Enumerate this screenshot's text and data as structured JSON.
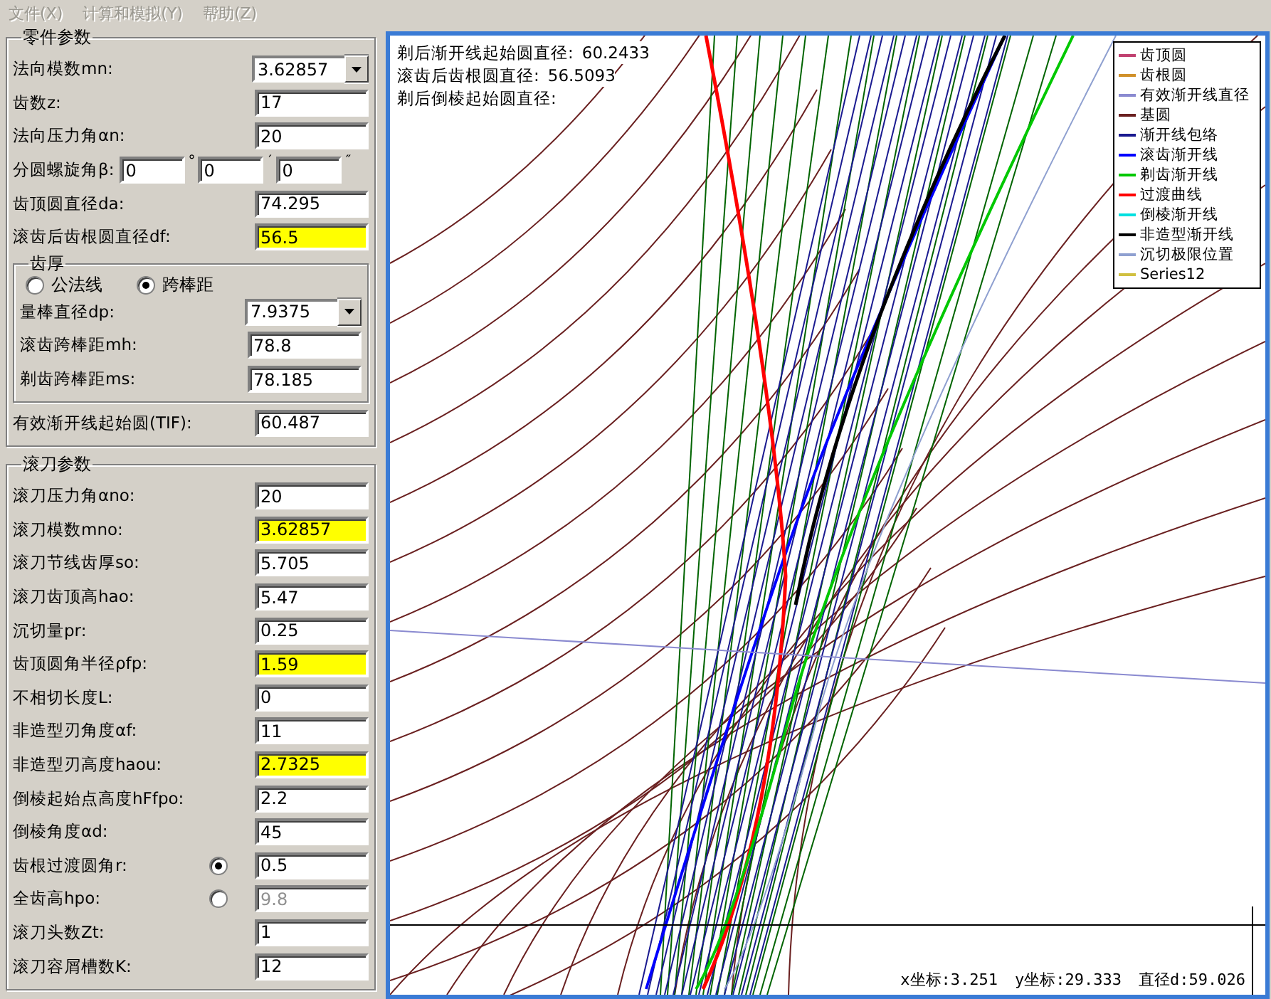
{
  "menu": [
    {
      "label": "文件(X)",
      "disabled": true
    },
    {
      "label": "计算和模拟(Y)",
      "disabled": true
    },
    {
      "label": "帮助(Z)",
      "disabled": true
    }
  ],
  "part_params": {
    "title": "零件参数",
    "items": [
      {
        "kind": "combo",
        "label": "法向模数mn:",
        "value": "3.62857",
        "highlighted": false
      },
      {
        "kind": "text",
        "label": "齿数z:",
        "value": "17",
        "highlighted": false
      },
      {
        "kind": "text",
        "label": "法向压力角αn:",
        "value": "20",
        "highlighted": false
      },
      {
        "kind": "angle",
        "label": "分圆螺旋角β:",
        "parts": [
          {
            "value": "0",
            "unit": "°"
          },
          {
            "value": "0",
            "unit": "′"
          },
          {
            "value": "0",
            "unit": "″"
          }
        ]
      },
      {
        "kind": "text",
        "label": "齿顶圆直径da:",
        "value": "74.295",
        "highlighted": false
      },
      {
        "kind": "text",
        "label": "滚齿后齿根圆直径df:",
        "value": "56.5",
        "highlighted": true
      },
      {
        "kind": "group",
        "title": "齿厚",
        "options": [
          {
            "label": "公法线",
            "selected": false
          },
          {
            "label": "跨棒距",
            "selected": true
          }
        ],
        "items": [
          {
            "kind": "combo",
            "label": "量棒直径dp:",
            "value": "7.9375",
            "highlighted": false
          },
          {
            "kind": "text",
            "label": "滚齿跨棒距mh:",
            "value": "78.8",
            "highlighted": false
          },
          {
            "kind": "text",
            "label": "剃齿跨棒距ms:",
            "value": "78.185",
            "highlighted": false
          }
        ]
      },
      {
        "kind": "text",
        "label": "有效渐开线起始圆(TIF):",
        "value": "60.487",
        "highlighted": false
      }
    ]
  },
  "hob_params": {
    "title": "滚刀参数",
    "items": [
      {
        "kind": "text",
        "label": "滚刀压力角αno:",
        "value": "20",
        "highlighted": false,
        "disabled": false
      },
      {
        "kind": "text",
        "label": "滚刀模数mno:",
        "value": "3.62857",
        "highlighted": true,
        "disabled": false
      },
      {
        "kind": "text",
        "label": "滚刀节线齿厚so:",
        "value": "5.705",
        "highlighted": false,
        "disabled": false
      },
      {
        "kind": "text",
        "label": "滚刀齿顶高hao:",
        "value": "5.47",
        "highlighted": false,
        "disabled": false
      },
      {
        "kind": "text",
        "label": "沉切量pr:",
        "value": "0.25",
        "highlighted": false,
        "disabled": false
      },
      {
        "kind": "text",
        "label": "齿顶圆角半径ρfp:",
        "value": "1.59",
        "highlighted": true,
        "disabled": false
      },
      {
        "kind": "text",
        "label": "不相切长度L:",
        "value": "0",
        "highlighted": false,
        "disabled": false
      },
      {
        "kind": "text",
        "label": "非造型刃角度αf:",
        "value": "11",
        "highlighted": false,
        "disabled": false
      },
      {
        "kind": "text",
        "label": "非造型刃高度haou:",
        "value": "2.7325",
        "highlighted": true,
        "disabled": false
      },
      {
        "kind": "text",
        "label": "倒棱起始点高度hFfpo:",
        "value": "2.2",
        "highlighted": false,
        "disabled": false
      },
      {
        "kind": "text",
        "label": "倒棱角度αd:",
        "value": "45",
        "highlighted": false,
        "disabled": false
      },
      {
        "kind": "radio_text",
        "label": "齿根过渡圆角r:",
        "selected": true,
        "value": "0.5",
        "highlighted": false,
        "disabled": false
      },
      {
        "kind": "radio_text",
        "label": "全齿高hpo:",
        "selected": false,
        "value": "9.8",
        "highlighted": false,
        "disabled": true
      },
      {
        "kind": "text",
        "label": "滚刀头数Zt:",
        "value": "1",
        "highlighted": false,
        "disabled": false
      },
      {
        "kind": "text",
        "label": "滚刀容屑槽数K:",
        "value": "12",
        "highlighted": false,
        "disabled": false
      }
    ]
  },
  "plot": {
    "info": [
      {
        "label": "剃后渐开线起始圆直径:",
        "value": "60.2433"
      },
      {
        "label": "滚齿后齿根圆直径:",
        "value": "56.5093"
      },
      {
        "label": "剃后倒棱起始圆直径:"
      }
    ],
    "legend": [
      {
        "label": "齿顶圆",
        "color": "#c04070"
      },
      {
        "label": "齿根圆",
        "color": "#d0902a"
      },
      {
        "label": "有效渐开线直径",
        "color": "#8a8ad0"
      },
      {
        "label": "基圆",
        "color": "#6a2020"
      },
      {
        "label": "渐开线包络",
        "color": "#1a1a90"
      },
      {
        "label": "滚齿渐开线",
        "color": "#0000ff"
      },
      {
        "label": "剃齿渐开线",
        "color": "#00c800"
      },
      {
        "label": "过渡曲线",
        "color": "#ff0000"
      },
      {
        "label": "倒棱渐开线",
        "color": "#00e0e0"
      },
      {
        "label": "非造型渐开线",
        "color": "#000000"
      },
      {
        "label": "沉切极限位置",
        "color": "#8fa0d0"
      },
      {
        "label": "Series12",
        "color": "#d0c040"
      }
    ],
    "status": [
      "x坐标:3.251",
      "y坐标:29.333",
      "直径d:59.026"
    ]
  }
}
